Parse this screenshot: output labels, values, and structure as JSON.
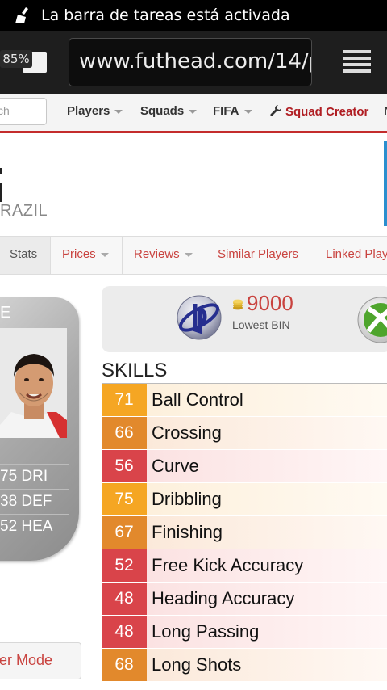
{
  "status_bar": {
    "text": "La barra de tareas está activada"
  },
  "browser": {
    "tab_percent": "85%",
    "url": "www.futhead.com/14/p"
  },
  "nav": {
    "search_placeholder": "ch",
    "items": [
      "Players",
      "Squads",
      "FIFA",
      "Squad Creator",
      "N"
    ]
  },
  "player": {
    "country": "RAZIL"
  },
  "tabs": [
    "Stats",
    "Prices",
    "Reviews",
    "Similar Players",
    "Linked Play"
  ],
  "card": {
    "name": "E",
    "stats": [
      "75 DRI",
      "38 DEF",
      "52 HEA"
    ]
  },
  "builder_button": "er Mode",
  "price": {
    "amount": "9000",
    "label": "Lowest BIN"
  },
  "skills": {
    "title": "SKILLS",
    "rows": [
      {
        "value": "71",
        "label": "Ball Control",
        "grade": "a"
      },
      {
        "value": "66",
        "label": "Crossing",
        "grade": "b"
      },
      {
        "value": "56",
        "label": "Curve",
        "grade": "c"
      },
      {
        "value": "75",
        "label": "Dribbling",
        "grade": "a"
      },
      {
        "value": "67",
        "label": "Finishing",
        "grade": "b"
      },
      {
        "value": "52",
        "label": "Free Kick Accuracy",
        "grade": "c"
      },
      {
        "value": "48",
        "label": "Heading Accuracy",
        "grade": "c"
      },
      {
        "value": "48",
        "label": "Long Passing",
        "grade": "c"
      },
      {
        "value": "68",
        "label": "Long Shots",
        "grade": "b"
      }
    ]
  },
  "colors": {
    "accent_red": "#b01e23",
    "link_red": "#c9433f",
    "grade_a": "#f5a623",
    "grade_b": "#e2892c",
    "grade_c": "#d9444a"
  }
}
